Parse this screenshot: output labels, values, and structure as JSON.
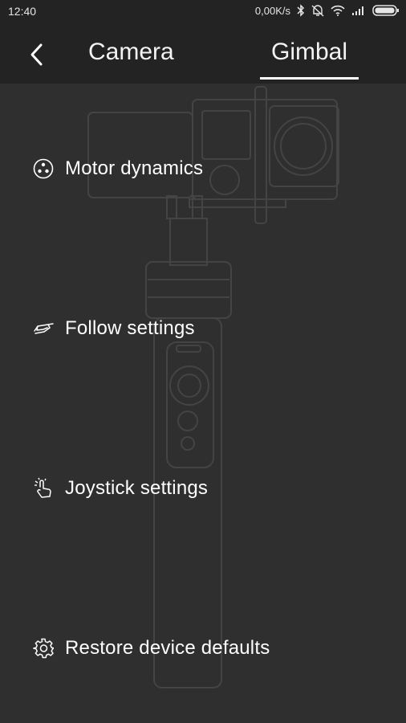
{
  "status_bar": {
    "time": "12:40",
    "network_speed": "0,00K/s",
    "icons": [
      "bluetooth-icon",
      "alarm-off-icon",
      "wifi-icon",
      "signal-icon",
      "battery-icon"
    ]
  },
  "nav": {
    "back_icon": "chevron-left-icon",
    "tabs": [
      {
        "label": "Camera",
        "active": false
      },
      {
        "label": "Gimbal",
        "active": true
      }
    ]
  },
  "menu": {
    "items": [
      {
        "label": "Motor dynamics",
        "icon": "motor-dynamics-icon"
      },
      {
        "label": "Follow settings",
        "icon": "follow-hand-icon"
      },
      {
        "label": "Joystick settings",
        "icon": "joystick-touch-icon"
      },
      {
        "label": "Restore device defaults",
        "icon": "gear-icon"
      }
    ]
  },
  "colors": {
    "background": "#2f2f2f",
    "bar_background": "#232323",
    "text": "#ffffff",
    "illustration_line": "#3f3f3f"
  }
}
